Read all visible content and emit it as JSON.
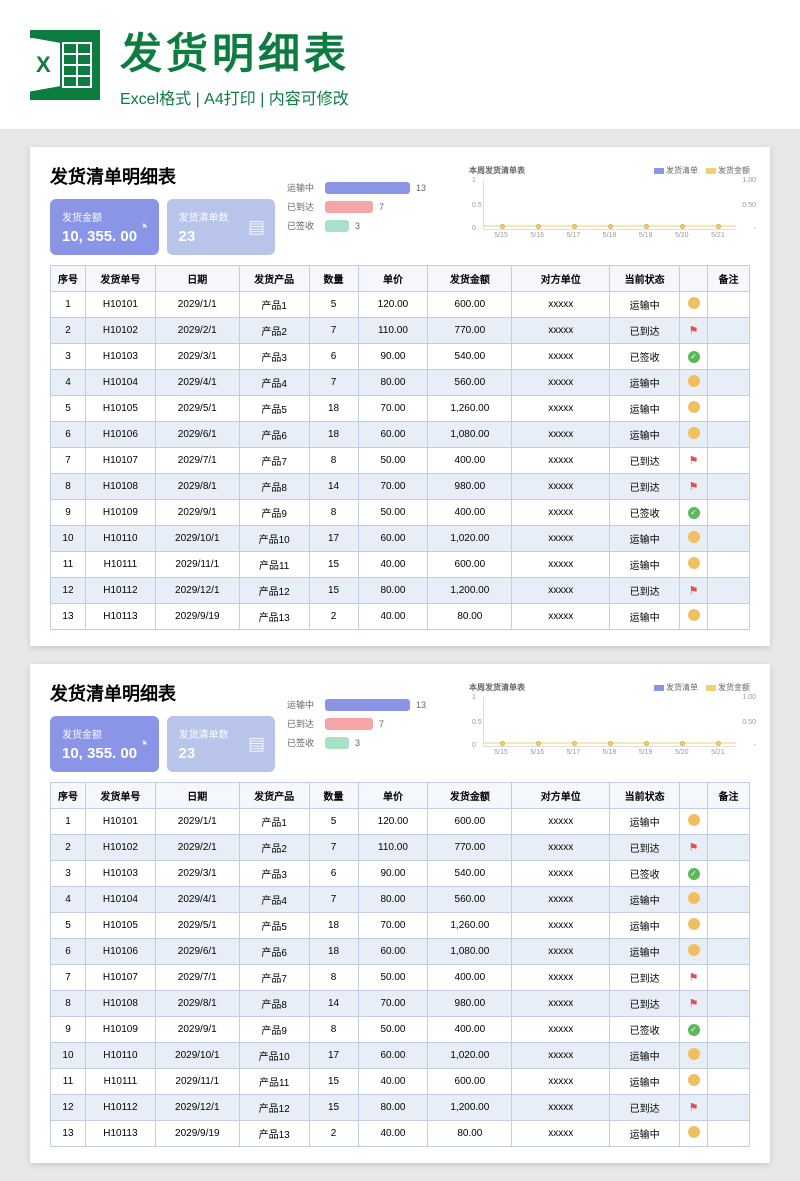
{
  "header": {
    "title": "发货明细表",
    "subtitle": "Excel格式 | A4打印 | 内容可修改"
  },
  "sheet": {
    "title": "发货清单明细表",
    "card1": {
      "label": "发货金额",
      "value": "10, 355. 00"
    },
    "card2": {
      "label": "发货清单数",
      "value": "23"
    },
    "bars": [
      {
        "label": "运输中",
        "value": "13"
      },
      {
        "label": "已到达",
        "value": "7"
      },
      {
        "label": "已签收",
        "value": "3"
      }
    ],
    "chart": {
      "title": "本周发货清单表",
      "legend1": "发货清单",
      "legend2": "发货金额",
      "y_left": [
        "1",
        "0.5",
        "0"
      ],
      "y_right": [
        "1.00",
        "0.50",
        "-"
      ],
      "x": [
        "5/15",
        "5/16",
        "5/17",
        "5/18",
        "5/19",
        "5/20",
        "5/21"
      ]
    },
    "columns": [
      "序号",
      "发货单号",
      "日期",
      "发货产品",
      "数量",
      "单价",
      "发货金额",
      "对方单位",
      "当前状态",
      "",
      "备注"
    ],
    "rows": [
      {
        "seq": "1",
        "id": "H10101",
        "date": "2029/1/1",
        "prod": "产品1",
        "qty": "5",
        "price": "120.00",
        "amt": "600.00",
        "party": "xxxxx",
        "stat": "运输中",
        "icon": "ship"
      },
      {
        "seq": "2",
        "id": "H10102",
        "date": "2029/2/1",
        "prod": "产品2",
        "qty": "7",
        "price": "110.00",
        "amt": "770.00",
        "party": "xxxxx",
        "stat": "已到达",
        "icon": "arr"
      },
      {
        "seq": "3",
        "id": "H10103",
        "date": "2029/3/1",
        "prod": "产品3",
        "qty": "6",
        "price": "90.00",
        "amt": "540.00",
        "party": "xxxxx",
        "stat": "已签收",
        "icon": "sign"
      },
      {
        "seq": "4",
        "id": "H10104",
        "date": "2029/4/1",
        "prod": "产品4",
        "qty": "7",
        "price": "80.00",
        "amt": "560.00",
        "party": "xxxxx",
        "stat": "运输中",
        "icon": "ship"
      },
      {
        "seq": "5",
        "id": "H10105",
        "date": "2029/5/1",
        "prod": "产品5",
        "qty": "18",
        "price": "70.00",
        "amt": "1,260.00",
        "party": "xxxxx",
        "stat": "运输中",
        "icon": "ship"
      },
      {
        "seq": "6",
        "id": "H10106",
        "date": "2029/6/1",
        "prod": "产品6",
        "qty": "18",
        "price": "60.00",
        "amt": "1,080.00",
        "party": "xxxxx",
        "stat": "运输中",
        "icon": "ship"
      },
      {
        "seq": "7",
        "id": "H10107",
        "date": "2029/7/1",
        "prod": "产品7",
        "qty": "8",
        "price": "50.00",
        "amt": "400.00",
        "party": "xxxxx",
        "stat": "已到达",
        "icon": "arr"
      },
      {
        "seq": "8",
        "id": "H10108",
        "date": "2029/8/1",
        "prod": "产品8",
        "qty": "14",
        "price": "70.00",
        "amt": "980.00",
        "party": "xxxxx",
        "stat": "已到达",
        "icon": "arr"
      },
      {
        "seq": "9",
        "id": "H10109",
        "date": "2029/9/1",
        "prod": "产品9",
        "qty": "8",
        "price": "50.00",
        "amt": "400.00",
        "party": "xxxxx",
        "stat": "已签收",
        "icon": "sign"
      },
      {
        "seq": "10",
        "id": "H10110",
        "date": "2029/10/1",
        "prod": "产品10",
        "qty": "17",
        "price": "60.00",
        "amt": "1,020.00",
        "party": "xxxxx",
        "stat": "运输中",
        "icon": "ship"
      },
      {
        "seq": "11",
        "id": "H10111",
        "date": "2029/11/1",
        "prod": "产品11",
        "qty": "15",
        "price": "40.00",
        "amt": "600.00",
        "party": "xxxxx",
        "stat": "运输中",
        "icon": "ship"
      },
      {
        "seq": "12",
        "id": "H10112",
        "date": "2029/12/1",
        "prod": "产品12",
        "qty": "15",
        "price": "80.00",
        "amt": "1,200.00",
        "party": "xxxxx",
        "stat": "已到达",
        "icon": "arr"
      },
      {
        "seq": "13",
        "id": "H10113",
        "date": "2029/9/19",
        "prod": "产品13",
        "qty": "2",
        "price": "40.00",
        "amt": "80.00",
        "party": "xxxxx",
        "stat": "运输中",
        "icon": "ship"
      }
    ]
  },
  "chart_data": {
    "type": "bar",
    "title": "本周发货清单表",
    "categories": [
      "运输中",
      "已到达",
      "已签收"
    ],
    "values": [
      13,
      7,
      3
    ],
    "secondary": {
      "type": "line",
      "title": "本周发货清单表",
      "x": [
        "5/15",
        "5/16",
        "5/17",
        "5/18",
        "5/19",
        "5/20",
        "5/21"
      ],
      "series": [
        {
          "name": "发货清单",
          "values": [
            0,
            0,
            0,
            0,
            0,
            0,
            0
          ],
          "ylim": [
            0,
            1
          ]
        },
        {
          "name": "发货金额",
          "values": [
            0,
            0,
            0,
            0,
            0,
            0,
            0
          ],
          "ylim": [
            0,
            1.0
          ]
        }
      ]
    }
  }
}
